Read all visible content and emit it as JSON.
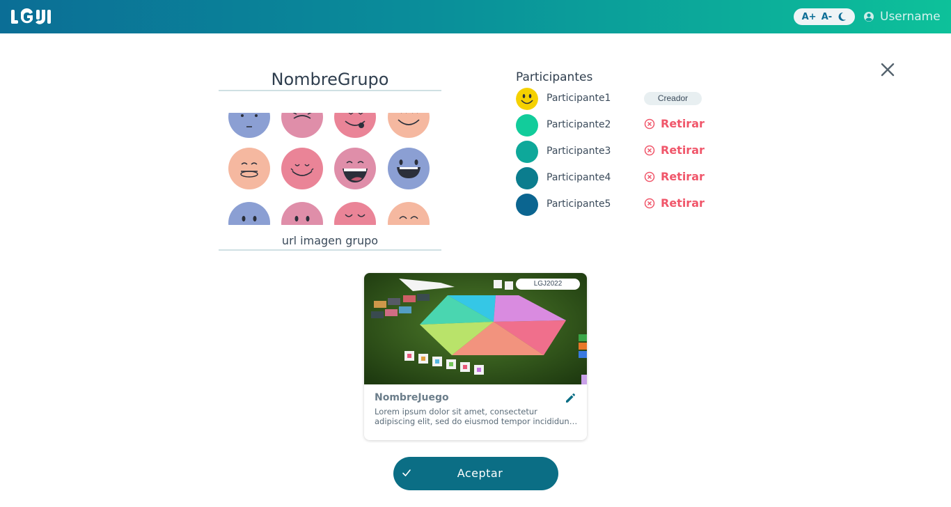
{
  "header": {
    "logo_text": "LGJ",
    "font_increase": "A+",
    "font_decrease": "A-",
    "username": "Username",
    "colors": {
      "gradient_start": "#0b6e96",
      "gradient_end": "#0dc19a"
    }
  },
  "group": {
    "name": "NombreGrupo",
    "url_placeholder": "url imagen grupo",
    "avatar_faces": [
      {
        "color": "#8b9fd3",
        "face": "neutral"
      },
      {
        "color": "#df8ea9",
        "face": "sad"
      },
      {
        "color": "#ea8497",
        "face": "tongue"
      },
      {
        "color": "#f5b8a0",
        "face": "smile"
      },
      {
        "color": "#f5b8a0",
        "face": "mouth-open-closed-eyes"
      },
      {
        "color": "#ea8497",
        "face": "smile-eyes"
      },
      {
        "color": "#df8ea9",
        "face": "laugh"
      },
      {
        "color": "#8b9fd3",
        "face": "grin"
      },
      {
        "color": "#8b9fd3",
        "face": "dots"
      },
      {
        "color": "#df8ea9",
        "face": "dots"
      },
      {
        "color": "#ea8497",
        "face": "content"
      },
      {
        "color": "#f5b8a0",
        "face": "happy-closed"
      }
    ]
  },
  "participants": {
    "title": "Participantes",
    "creator_label": "Creador",
    "remove_label": "Retirar",
    "items": [
      {
        "name": "Participante1",
        "color": "#f5d100",
        "role": "creator"
      },
      {
        "name": "Participante2",
        "color": "#12cc9b",
        "role": "member"
      },
      {
        "name": "Participante3",
        "color": "#0ea89a",
        "role": "member"
      },
      {
        "name": "Participante4",
        "color": "#0b7d8e",
        "role": "member"
      },
      {
        "name": "Participante5",
        "color": "#0b6590",
        "role": "member"
      }
    ]
  },
  "game": {
    "tag": "LGJ2022",
    "title": "NombreJuego",
    "description": "Lorem ipsum dolor sit amet, consectetur adipiscing elit, sed do eiusmod tempor incididunt ut labore..."
  },
  "actions": {
    "accept_label": "Aceptar"
  }
}
